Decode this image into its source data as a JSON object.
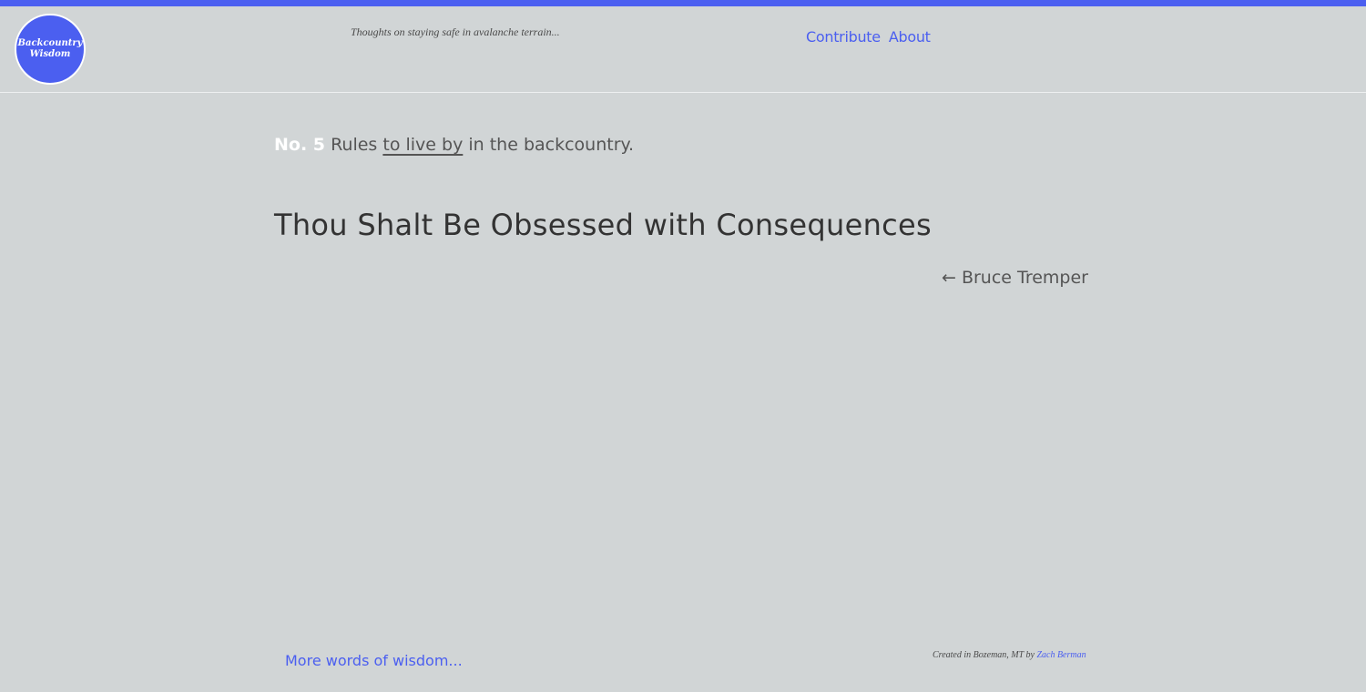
{
  "colors": {
    "accent": "#4b5ff0",
    "background": "#d1d5d6",
    "text": "#333333"
  },
  "header": {
    "logo_line1": "Backcountry",
    "logo_line2": "Wisdom",
    "tagline": "Thoughts on staying safe in avalanche terrain...",
    "nav": {
      "contribute": "Contribute",
      "about": "About"
    }
  },
  "main": {
    "rule_number": "No. 5",
    "rule_text_before": "Rules",
    "rule_text_underlined": "to live by",
    "rule_text_after": "in the backcountry.",
    "headline": "Thou Shalt Be Obsessed with Consequences",
    "attribution": "← Bruce Tremper"
  },
  "footer": {
    "more_link": "More words of wisdom...",
    "credits_prefix": "Created in Bozeman, MT by",
    "author_link": "Zach Berman"
  }
}
